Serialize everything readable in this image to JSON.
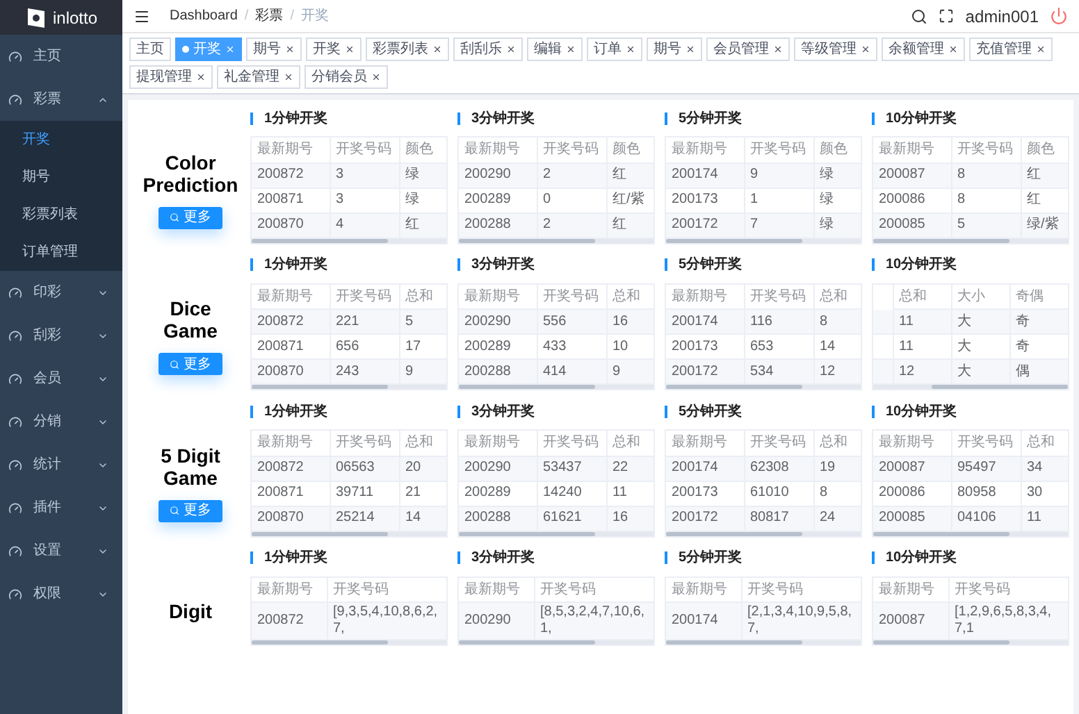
{
  "sidebar": {
    "logo": "inlotto",
    "items": [
      {
        "label": "主页",
        "expandable": false
      },
      {
        "label": "彩票",
        "expandable": true,
        "expanded": true,
        "children": [
          {
            "label": "开奖",
            "selected": true
          },
          {
            "label": "期号",
            "selected": false
          },
          {
            "label": "彩票列表",
            "selected": false
          },
          {
            "label": "订单管理",
            "selected": false
          }
        ]
      },
      {
        "label": "印彩",
        "expandable": true,
        "expanded": false
      },
      {
        "label": "刮彩",
        "expandable": true,
        "expanded": false
      },
      {
        "label": "会员",
        "expandable": true,
        "expanded": false
      },
      {
        "label": "分销",
        "expandable": true,
        "expanded": false
      },
      {
        "label": "统计",
        "expandable": true,
        "expanded": false
      },
      {
        "label": "插件",
        "expandable": true,
        "expanded": false
      },
      {
        "label": "设置",
        "expandable": true,
        "expanded": false
      },
      {
        "label": "权限",
        "expandable": true,
        "expanded": false
      }
    ]
  },
  "header": {
    "breadcrumb": [
      {
        "kind": "link",
        "text": "Dashboard"
      },
      {
        "kind": "separator",
        "text": "/"
      },
      {
        "kind": "link",
        "text": "彩票"
      },
      {
        "kind": "separator",
        "text": "/"
      },
      {
        "kind": "current",
        "text": "开奖"
      }
    ],
    "user": "admin001"
  },
  "tags": [
    {
      "label": "主页",
      "selected": false,
      "closable": false
    },
    {
      "label": "开奖",
      "selected": true,
      "closable": true
    },
    {
      "label": "期号",
      "selected": false,
      "closable": true
    },
    {
      "label": "开奖",
      "selected": false,
      "closable": true
    },
    {
      "label": "彩票列表",
      "selected": false,
      "closable": true
    },
    {
      "label": "刮刮乐",
      "selected": false,
      "closable": true
    },
    {
      "label": "编辑",
      "selected": false,
      "closable": true
    },
    {
      "label": "订单",
      "selected": false,
      "closable": true
    },
    {
      "label": "期号",
      "selected": false,
      "closable": true
    },
    {
      "label": "会员管理",
      "selected": false,
      "closable": true
    },
    {
      "label": "等级管理",
      "selected": false,
      "closable": true
    },
    {
      "label": "余额管理",
      "selected": false,
      "closable": true
    },
    {
      "label": "充值管理",
      "selected": false,
      "closable": true
    },
    {
      "label": "提现管理",
      "selected": false,
      "closable": true
    },
    {
      "label": "礼金管理",
      "selected": false,
      "closable": true
    },
    {
      "label": "分销会员",
      "selected": false,
      "closable": true
    }
  ],
  "sections": [
    {
      "title_lines": [
        "Color",
        "Prediction"
      ],
      "button": "更多",
      "tables": [
        {
          "title": "1分钟开奖",
          "scrolled_left": false,
          "columns": [
            "最新期号",
            "开奖号码",
            "颜色"
          ],
          "rows": [
            [
              "200872",
              "3",
              "绿"
            ],
            [
              "200871",
              "3",
              "绿"
            ],
            [
              "200870",
              "4",
              "红"
            ]
          ]
        },
        {
          "title": "3分钟开奖",
          "scrolled_left": false,
          "columns": [
            "最新期号",
            "开奖号码",
            "颜色"
          ],
          "rows": [
            [
              "200290",
              "2",
              "红"
            ],
            [
              "200289",
              "0",
              "红/紫"
            ],
            [
              "200288",
              "2",
              "红"
            ]
          ]
        },
        {
          "title": "5分钟开奖",
          "scrolled_left": false,
          "columns": [
            "最新期号",
            "开奖号码",
            "颜色"
          ],
          "rows": [
            [
              "200174",
              "9",
              "绿"
            ],
            [
              "200173",
              "1",
              "绿"
            ],
            [
              "200172",
              "7",
              "绿"
            ]
          ]
        },
        {
          "title": "10分钟开奖",
          "scrolled_left": false,
          "columns": [
            "最新期号",
            "开奖号码",
            "颜色"
          ],
          "rows": [
            [
              "200087",
              "8",
              "红"
            ],
            [
              "200086",
              "8",
              "红"
            ],
            [
              "200085",
              "5",
              "绿/紫"
            ]
          ]
        }
      ]
    },
    {
      "title_lines": [
        "Dice",
        "Game"
      ],
      "button": "更多",
      "tables": [
        {
          "title": "1分钟开奖",
          "scrolled_left": false,
          "columns": [
            "最新期号",
            "开奖号码",
            "总和"
          ],
          "rows": [
            [
              "200872",
              "221",
              "5"
            ],
            [
              "200871",
              "656",
              "17"
            ],
            [
              "200870",
              "243",
              "9"
            ]
          ]
        },
        {
          "title": "3分钟开奖",
          "scrolled_left": false,
          "columns": [
            "最新期号",
            "开奖号码",
            "总和"
          ],
          "rows": [
            [
              "200290",
              "556",
              "16"
            ],
            [
              "200289",
              "433",
              "10"
            ],
            [
              "200288",
              "414",
              "9"
            ]
          ]
        },
        {
          "title": "5分钟开奖",
          "scrolled_left": false,
          "columns": [
            "最新期号",
            "开奖号码",
            "总和"
          ],
          "rows": [
            [
              "200174",
              "116",
              "8"
            ],
            [
              "200173",
              "653",
              "14"
            ],
            [
              "200172",
              "534",
              "12"
            ]
          ]
        },
        {
          "title": "10分钟开奖",
          "scrolled_left": true,
          "columns": [
            "总和",
            "大小",
            "奇偶"
          ],
          "rows": [
            [
              "11",
              "大",
              "奇"
            ],
            [
              "11",
              "大",
              "奇"
            ],
            [
              "12",
              "大",
              "偶"
            ]
          ]
        }
      ]
    },
    {
      "title_lines": [
        "5 Digit",
        "Game"
      ],
      "button": "更多",
      "tables": [
        {
          "title": "1分钟开奖",
          "scrolled_left": false,
          "columns": [
            "最新期号",
            "开奖号码",
            "总和"
          ],
          "rows": [
            [
              "200872",
              "06563",
              "20"
            ],
            [
              "200871",
              "39711",
              "21"
            ],
            [
              "200870",
              "25214",
              "14"
            ]
          ]
        },
        {
          "title": "3分钟开奖",
          "scrolled_left": false,
          "columns": [
            "最新期号",
            "开奖号码",
            "总和"
          ],
          "rows": [
            [
              "200290",
              "53437",
              "22"
            ],
            [
              "200289",
              "14240",
              "11"
            ],
            [
              "200288",
              "61621",
              "16"
            ]
          ]
        },
        {
          "title": "5分钟开奖",
          "scrolled_left": false,
          "columns": [
            "最新期号",
            "开奖号码",
            "总和"
          ],
          "rows": [
            [
              "200174",
              "62308",
              "19"
            ],
            [
              "200173",
              "61010",
              "8"
            ],
            [
              "200172",
              "80817",
              "24"
            ]
          ]
        },
        {
          "title": "10分钟开奖",
          "scrolled_left": false,
          "columns": [
            "最新期号",
            "开奖号码",
            "总和"
          ],
          "rows": [
            [
              "200087",
              "95497",
              "34"
            ],
            [
              "200086",
              "80958",
              "30"
            ],
            [
              "200085",
              "04106",
              "11"
            ]
          ]
        }
      ]
    },
    {
      "title_lines": [
        "Digit"
      ],
      "tables": [
        {
          "title": "1分钟开奖",
          "scrolled_left": false,
          "columns": [
            "最新期号",
            "开奖号码"
          ],
          "rows": [
            [
              "200872",
              "[9,3,5,4,10,8,6,2,7,"
            ]
          ]
        },
        {
          "title": "3分钟开奖",
          "scrolled_left": false,
          "columns": [
            "最新期号",
            "开奖号码"
          ],
          "rows": [
            [
              "200290",
              "[8,5,3,2,4,7,10,6,1,"
            ]
          ]
        },
        {
          "title": "5分钟开奖",
          "scrolled_left": false,
          "columns": [
            "最新期号",
            "开奖号码"
          ],
          "rows": [
            [
              "200174",
              "[2,1,3,4,10,9,5,8,7,"
            ]
          ]
        },
        {
          "title": "10分钟开奖",
          "scrolled_left": false,
          "columns": [
            "最新期号",
            "开奖号码"
          ],
          "rows": [
            [
              "200087",
              "[1,2,9,6,5,8,3,4,7,1"
            ]
          ]
        }
      ]
    }
  ]
}
